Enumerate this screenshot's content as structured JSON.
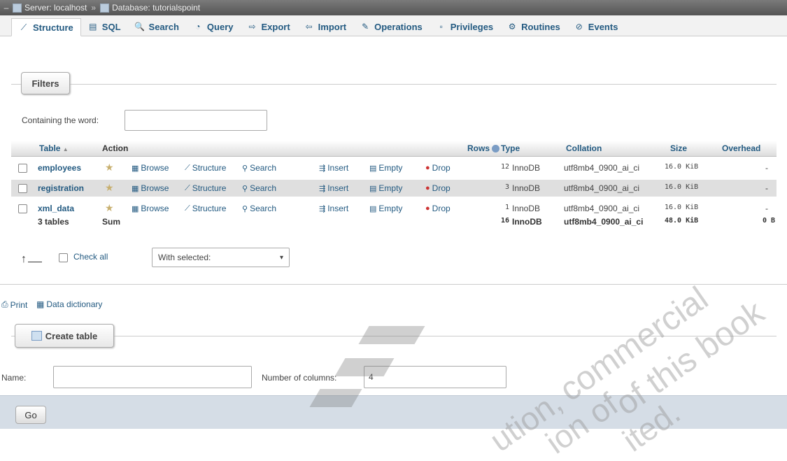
{
  "breadcrumb": {
    "server": "Server: localhost",
    "separator": "»",
    "database": "Database: tutorialspoint"
  },
  "tabs": [
    {
      "label": "Structure",
      "icon": "structure-icon",
      "glyph": "⟋"
    },
    {
      "label": "SQL",
      "icon": "sql-icon",
      "glyph": "▤"
    },
    {
      "label": "Search",
      "icon": "search-icon",
      "glyph": "🔍"
    },
    {
      "label": "Query",
      "icon": "query-icon",
      "glyph": "◔"
    },
    {
      "label": "Export",
      "icon": "export-icon",
      "glyph": "⇨"
    },
    {
      "label": "Import",
      "icon": "import-icon",
      "glyph": "⇦"
    },
    {
      "label": "Operations",
      "icon": "wrench-icon",
      "glyph": "✎"
    },
    {
      "label": "Privileges",
      "icon": "privileges-icon",
      "glyph": "▫"
    },
    {
      "label": "Routines",
      "icon": "routines-icon",
      "glyph": "⚙"
    },
    {
      "label": "Events",
      "icon": "events-icon",
      "glyph": "⊘"
    }
  ],
  "filters": {
    "legend": "Filters",
    "label": "Containing the word:",
    "value": ""
  },
  "table": {
    "headers": {
      "table": "Table",
      "sort_glyph": "▲",
      "action": "Action",
      "rows": "Rows",
      "type": "Type",
      "collation": "Collation",
      "size": "Size",
      "overhead": "Overhead"
    },
    "actions": [
      "Browse",
      "Structure",
      "Search",
      "Insert",
      "Empty",
      "Drop"
    ],
    "rows": [
      {
        "name": "employees",
        "rows": "12",
        "type": "InnoDB",
        "collation": "utf8mb4_0900_ai_ci",
        "size": "16.0 KiB",
        "overhead": "-"
      },
      {
        "name": "registration",
        "rows": "3",
        "type": "InnoDB",
        "collation": "utf8mb4_0900_ai_ci",
        "size": "16.0 KiB",
        "overhead": "-"
      },
      {
        "name": "xml_data",
        "rows": "1",
        "type": "InnoDB",
        "collation": "utf8mb4_0900_ai_ci",
        "size": "16.0 KiB",
        "overhead": "-"
      }
    ],
    "summary": {
      "tables": "3 tables",
      "sum": "Sum",
      "rows": "16",
      "type": "InnoDB",
      "collation": "utf8mb4_0900_ai_ci",
      "size": "48.0 KiB",
      "overhead": "0 B"
    }
  },
  "bulk": {
    "check_all": "Check all",
    "with_selected": "With selected:"
  },
  "links": {
    "print": "Print",
    "data_dictionary": "Data dictionary"
  },
  "create": {
    "legend": "Create table",
    "name_label": "Name:",
    "name_value": "",
    "columns_label": "Number of columns:",
    "columns_value": "4",
    "go": "Go"
  },
  "watermark": {
    "line1": "commercial",
    "line2": "of this book",
    "line3": "ution,",
    "line4": "ion of",
    "line5": "ited."
  },
  "colors": {
    "link": "#235a81",
    "row_even": "#dfdfdf",
    "bottom_bar": "#d5dde6"
  }
}
